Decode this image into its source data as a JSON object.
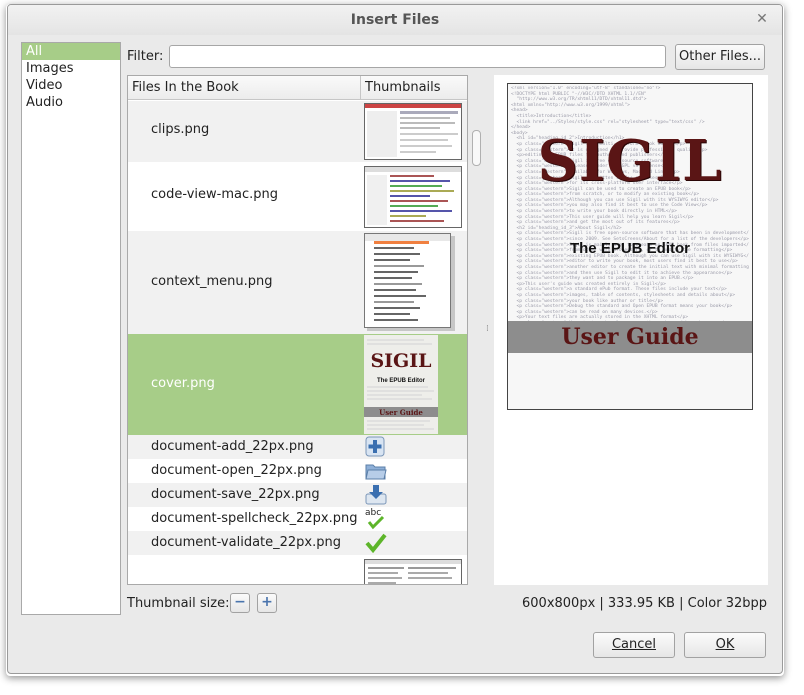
{
  "window": {
    "title": "Insert Files"
  },
  "categories": [
    {
      "label": "All",
      "selected": true
    },
    {
      "label": "Images",
      "selected": false
    },
    {
      "label": "Video",
      "selected": false
    },
    {
      "label": "Audio",
      "selected": false
    }
  ],
  "filter": {
    "label": "Filter:",
    "value": "",
    "placeholder": ""
  },
  "other_files_button": "Other Files...",
  "table": {
    "headers": [
      "Files In the Book",
      "Thumbnails"
    ],
    "rows": [
      {
        "name": "clips.png",
        "thumbnail": "screenshot-thumb"
      },
      {
        "name": "code-view-mac.png",
        "thumbnail": "screenshot-thumb"
      },
      {
        "name": "context_menu.png",
        "thumbnail": "menu-thumb"
      },
      {
        "name": "cover.png",
        "thumbnail": "cover-thumb",
        "selected": true
      },
      {
        "name": "document-add_22px.png",
        "thumbnail": "plus-icon"
      },
      {
        "name": "document-open_22px.png",
        "thumbnail": "folder-icon"
      },
      {
        "name": "document-save_22px.png",
        "thumbnail": "save-icon"
      },
      {
        "name": "document-spellcheck_22px.png",
        "thumbnail": "spellcheck-icon"
      },
      {
        "name": "document-validate_22px.png",
        "thumbnail": "checkmark-icon"
      },
      {
        "name": "",
        "thumbnail": "screenshot-thumb"
      }
    ]
  },
  "preview": {
    "title": "SIGIL",
    "subtitle": "The EPUB Editor",
    "band": "User Guide"
  },
  "footer": {
    "thumbnail_size_label": "Thumbnail size:",
    "image_info": "600x800px | 333.95 KB | Color 32bpp",
    "cancel": "Cancel",
    "ok": "OK"
  },
  "colors": {
    "selection": "#a7cd88",
    "window_bg": "#eaeaea",
    "title_red": "#5a1515"
  }
}
